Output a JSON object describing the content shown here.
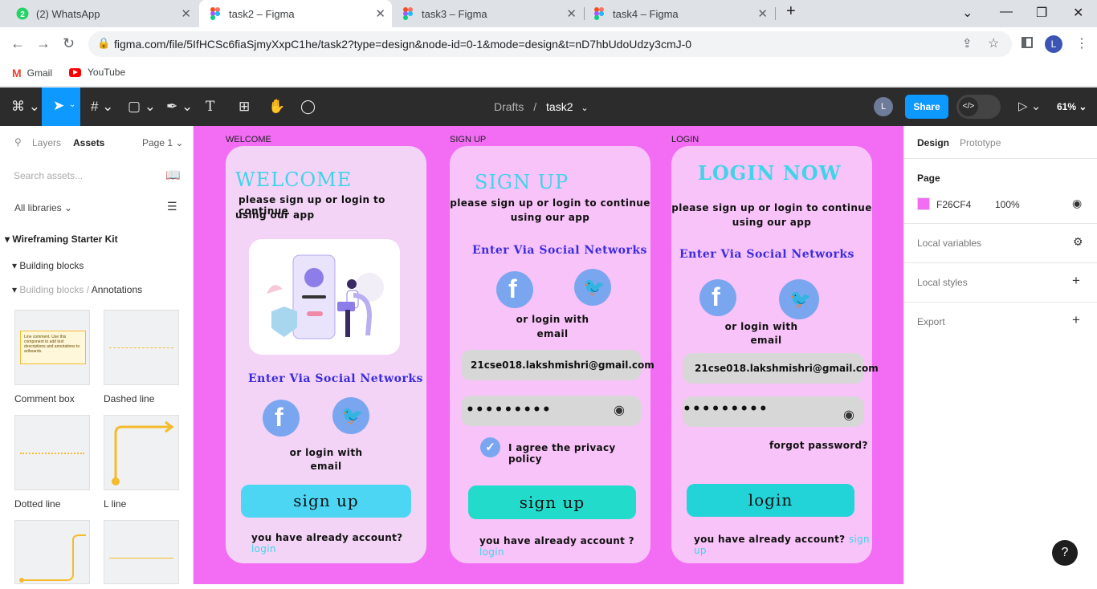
{
  "browser": {
    "tabs": [
      {
        "title": "(2) WhatsApp",
        "icon": "whatsapp-icon"
      },
      {
        "title": "task2 – Figma",
        "icon": "figma-icon",
        "active": true
      },
      {
        "title": "task3 – Figma",
        "icon": "figma-icon"
      },
      {
        "title": "task4 – Figma",
        "icon": "figma-icon"
      }
    ],
    "new_tab": "+",
    "url": "figma.com/file/5IfHCSc6fiaSjmyXxpC1he/task2?type=design&node-id=0-1&mode=design&t=nD7hbUdoUdzy3cmJ-0",
    "profile_initial": "L",
    "bookmarks": [
      "Gmail",
      "YouTube"
    ]
  },
  "figma_toolbar": {
    "breadcrumb_root": "Drafts",
    "breadcrumb_sep": "/",
    "file_name": "task2",
    "avatar": "L",
    "share_label": "Share",
    "zoom": "61%"
  },
  "left_panel": {
    "tabs": [
      "Layers",
      "Assets"
    ],
    "page_selector": "Page 1",
    "search_placeholder": "Search assets...",
    "libraries": "All libraries",
    "kit_title": "Wireframing Starter Kit",
    "group1": "Building blocks",
    "group2_parent": "Building blocks /",
    "group2_child": "Annotations",
    "comment_thumb_text": "Line comment. Use this component to add text descriptions and annotations to artboards.",
    "thumbs": [
      "Comment box",
      "Dashed line",
      "Dotted line",
      "L line"
    ]
  },
  "canvas": {
    "background": "#f26cf4",
    "frames": [
      {
        "label": "WELCOME",
        "heading": "WELCOME",
        "subtitle_line1": "please sign up or login to continue",
        "subtitle_line2": "using our app",
        "social_title": "Enter Via Social Networks",
        "or_line1": "or login with",
        "or_line2": "email",
        "button": "sign up",
        "footer": "you have already account?",
        "footer_link": "login"
      },
      {
        "label": "SIGN UP",
        "heading": "SIGN UP",
        "subtitle_line1": "please sign up or login to continue",
        "subtitle_line2": "using our app",
        "social_title": "Enter Via Social Networks",
        "or_line1": "or login with",
        "or_line2": "email",
        "email": "21cse018.lakshmishri@gmail.com",
        "password": "•••••••••",
        "agree": "I agree the privacy policy",
        "button": "sign up",
        "footer": "you have already account ?",
        "footer_link": "login"
      },
      {
        "label": "LOGIN",
        "heading": "LOGIN NOW",
        "subtitle_line1": "please sign up or login to continue",
        "subtitle_line2": "using our app",
        "social_title": "Enter Via Social Networks",
        "or_line1": "or login with",
        "or_line2": "email",
        "email": "21cse018.lakshmishri@gmail.com",
        "password": "•••••••••",
        "forgot": "forgot password?",
        "button": "login",
        "footer": "you have already account?",
        "footer_link": "sign up"
      }
    ]
  },
  "right_panel": {
    "tabs": [
      "Design",
      "Prototype"
    ],
    "page_section": "Page",
    "page_color_hex": "F26CF4",
    "page_color": "#f26cf4",
    "page_opacity": "100%",
    "sections": [
      "Local variables",
      "Local styles",
      "Export"
    ]
  },
  "help": "?"
}
